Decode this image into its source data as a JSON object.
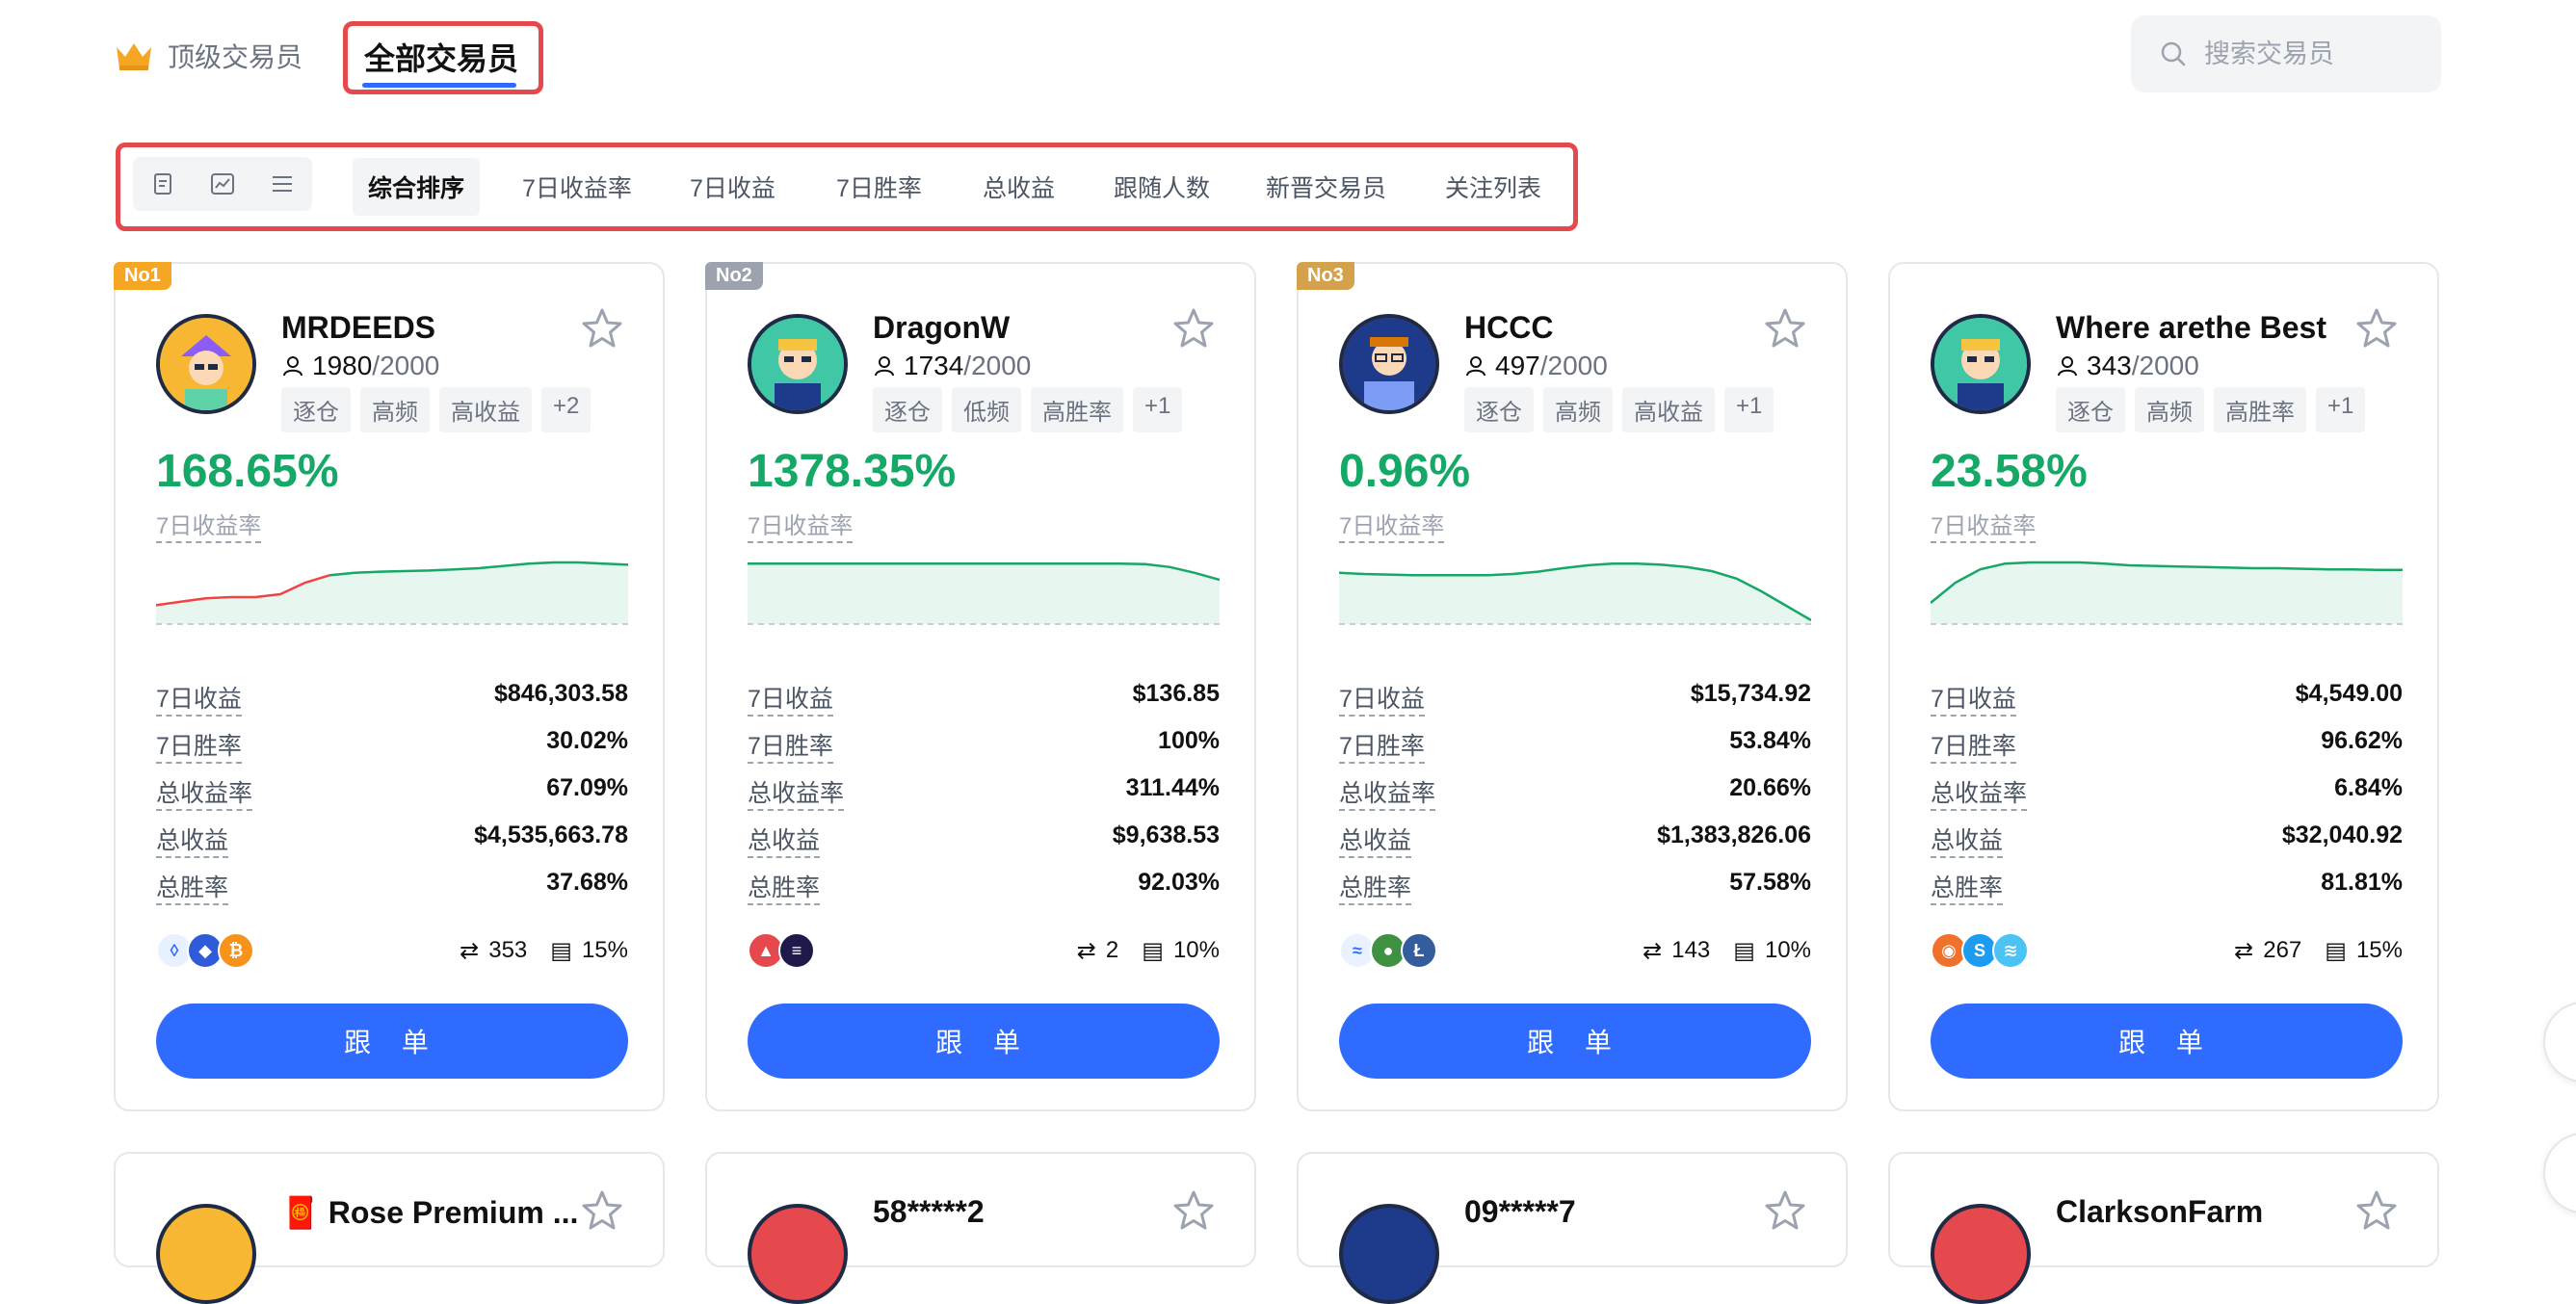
{
  "header": {
    "tab_top": "顶级交易员",
    "tab_all": "全部交易员",
    "search_placeholder": "搜索交易员"
  },
  "filter": {
    "view_icons": [
      "card-view-icon",
      "chart-view-icon",
      "list-view-icon"
    ],
    "sort_tabs": [
      "综合排序",
      "7日收益率",
      "7日收益",
      "7日胜率",
      "总收益",
      "跟随人数",
      "新晋交易员",
      "关注列表"
    ],
    "active_sort": "综合排序"
  },
  "labels": {
    "roi_label": "7日收益率",
    "stat_keys": [
      "7日收益",
      "7日胜率",
      "总收益率",
      "总收益",
      "总胜率"
    ],
    "follow_button": "跟 单",
    "followers_sep": "/"
  },
  "colors": {
    "accent": "#2f6bff",
    "positive": "#16a866",
    "negative": "#ef4444",
    "highlight_box": "#e5484d",
    "rank1": "#f5a623",
    "rank2": "#9ca3af",
    "rank3": "#d4a24c"
  },
  "traders": [
    {
      "rank": "No1",
      "name": "MRDEEDS",
      "followers": "1980",
      "max": "2000",
      "tags": [
        "逐仓",
        "高频",
        "高收益",
        "+2"
      ],
      "roi": "168.65%",
      "stats": [
        "$846,303.58",
        "30.02%",
        "67.09%",
        "$4,535,663.78",
        "37.68%"
      ],
      "trades": "353",
      "share": "15%",
      "coins": [
        "link-coin",
        "eth-coin",
        "btc-coin"
      ],
      "spark": [
        0.74,
        0.68,
        0.62,
        0.6,
        0.6,
        0.55,
        0.35,
        0.22,
        0.18,
        0.16,
        0.15,
        0.14,
        0.12,
        0.1,
        0.06,
        0.02,
        0.0,
        0.0,
        0.02,
        0.04
      ]
    },
    {
      "rank": "No2",
      "name": "DragonW",
      "followers": "1734",
      "max": "2000",
      "tags": [
        "逐仓",
        "低频",
        "高胜率",
        "+1"
      ],
      "roi": "1378.35%",
      "stats": [
        "$136.85",
        "100%",
        "311.44%",
        "$9,638.53",
        "92.03%"
      ],
      "trades": "2",
      "share": "10%",
      "coins": [
        "arb-coin",
        "ena-coin"
      ],
      "spark": [
        0.02,
        0.02,
        0.02,
        0.02,
        0.02,
        0.02,
        0.02,
        0.02,
        0.02,
        0.02,
        0.02,
        0.02,
        0.02,
        0.02,
        0.02,
        0.02,
        0.03,
        0.08,
        0.18,
        0.3
      ]
    },
    {
      "rank": "No3",
      "name": "HCCC",
      "followers": "497",
      "max": "2000",
      "tags": [
        "逐仓",
        "高频",
        "高收益",
        "+1"
      ],
      "roi": "0.96%",
      "stats": [
        "$15,734.92",
        "53.84%",
        "20.66%",
        "$1,383,826.06",
        "57.58%"
      ],
      "trades": "143",
      "share": "10%",
      "coins": [
        "sei-coin",
        "pepe-coin",
        "ltc-coin"
      ],
      "spark": [
        0.18,
        0.2,
        0.21,
        0.22,
        0.22,
        0.22,
        0.22,
        0.2,
        0.16,
        0.1,
        0.05,
        0.02,
        0.02,
        0.04,
        0.08,
        0.15,
        0.28,
        0.5,
        0.75,
        1.0
      ]
    },
    {
      "rank": "",
      "name": "Where arethe Best",
      "followers": "343",
      "max": "2000",
      "tags": [
        "逐仓",
        "高频",
        "高胜率",
        "+1"
      ],
      "roi": "23.58%",
      "stats": [
        "$4,549.00",
        "96.62%",
        "6.84%",
        "$32,040.92",
        "81.81%"
      ],
      "trades": "267",
      "share": "15%",
      "coins": [
        "shib-coin",
        "s-coin",
        "sui-coin"
      ],
      "spark": [
        0.7,
        0.35,
        0.12,
        0.02,
        0.0,
        0.0,
        0.0,
        0.02,
        0.05,
        0.06,
        0.07,
        0.08,
        0.09,
        0.1,
        0.1,
        0.11,
        0.12,
        0.12,
        0.13,
        0.13
      ]
    }
  ],
  "row2": [
    {
      "name": "🧧 Rose Premium ..."
    },
    {
      "name": "58*****2"
    },
    {
      "name": "09*****7"
    },
    {
      "name": "ClarksonFarm"
    }
  ]
}
